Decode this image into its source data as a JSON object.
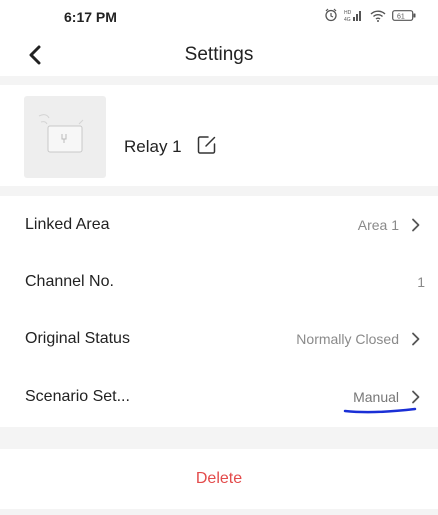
{
  "status_bar": {
    "time": "6:17 PM",
    "battery": "61"
  },
  "header": {
    "title": "Settings"
  },
  "device": {
    "name": "Relay 1"
  },
  "settings": [
    {
      "label": "Linked Area",
      "value": "Area 1"
    },
    {
      "label": "Channel No.",
      "value": "1"
    },
    {
      "label": "Original Status",
      "value": "Normally Closed"
    },
    {
      "label": "Scenario Set...",
      "value": "Manual"
    }
  ],
  "actions": {
    "delete_label": "Delete"
  },
  "colors": {
    "delete_text": "#e34b4b",
    "annotation_underline": "#1a2fd6"
  }
}
